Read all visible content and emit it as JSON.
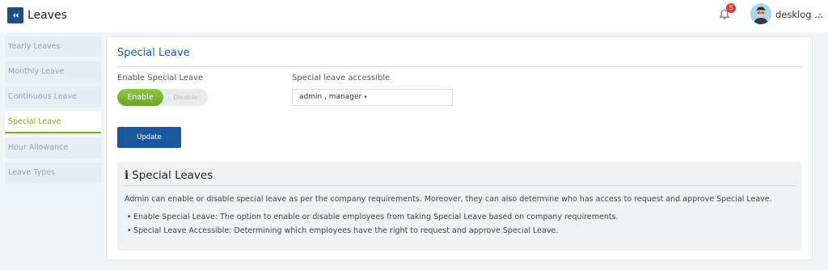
{
  "header": {
    "title": "Leaves",
    "back_icon": "double-chevron-left-icon",
    "notification_count": "5",
    "user_name": "desklog ...",
    "colors": {
      "brand": "#1c4f8a",
      "badge": "#e53935"
    }
  },
  "sidebar": {
    "items": [
      {
        "label": "Yearly Leaves"
      },
      {
        "label": "Monthly Leave"
      },
      {
        "label": "Continuous Leave"
      },
      {
        "label": "Special Leave",
        "active": true
      },
      {
        "label": "Hour Allowance"
      },
      {
        "label": "Leave Types"
      }
    ],
    "active_color": "#7ab317"
  },
  "main": {
    "title": "Special Leave",
    "enable_label": "Enable Special Leave",
    "toggle": {
      "on_label": "Enable",
      "off_label": "Disable",
      "state": "Enable"
    },
    "access_label": "Special leave accessible",
    "access_value": "admin , manager",
    "update_label": "Update"
  },
  "info": {
    "icon": "info-icon",
    "title": "Special Leaves",
    "description": "Admin can enable or disable special leave as per the company requirements. Moreover, they can also determine who has access to request and approve Special Leave.",
    "points": [
      "Enable Special Leave: The option to enable or disable employees from taking Special Leave based on company requirements.",
      "Special Leave Accessible: Determining which employees have the right to request and approve Special Leave."
    ]
  }
}
